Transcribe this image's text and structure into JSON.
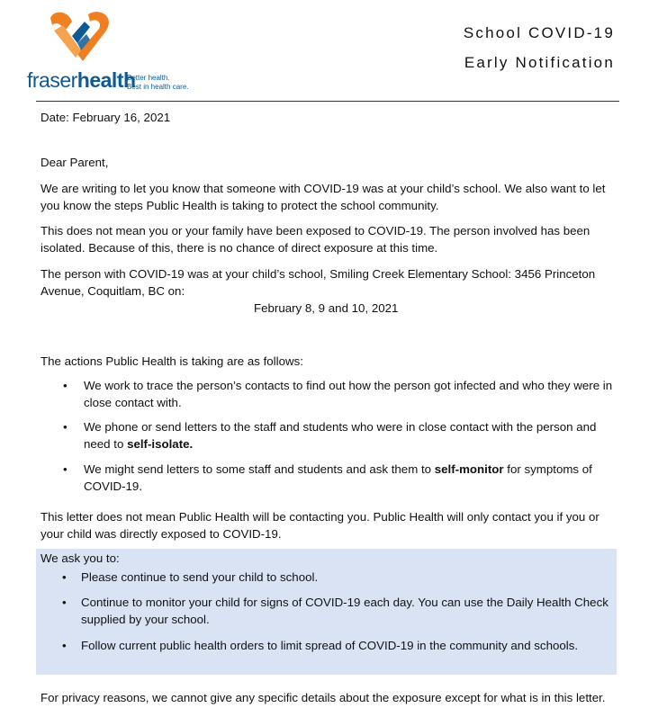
{
  "header": {
    "brand_light": "fraser",
    "brand_bold": "health",
    "tagline_1": "Better health.",
    "tagline_2": "Best in health care.",
    "title_line1": "School COVID-19",
    "title_line2": "Early Notification",
    "brand_colors": {
      "orange": "#f07f22",
      "blue": "#0e5a96"
    }
  },
  "date_line": "Date: February 16, 2021",
  "greeting": "Dear Parent,",
  "para1": "We are writing to let you know that someone with COVID-19 was at your child’s school. We also want to let you know the steps Public Health is taking to protect the school community.",
  "para2": "This does not mean you or your family have been exposed to COVID-19. The person involved has been isolated. Because of this, there is no chance of direct exposure at this time.",
  "para3": "The person with COVID-19 was at your child’s school, Smiling Creek Elementary School:  3456 Princeton Avenue, Coquitlam, BC on:",
  "dates": "February 8, 9 and 10, 2021",
  "actions_intro": "The actions Public Health is taking are as follows:",
  "actions": [
    {
      "text": "We work to trace the person’s contacts to find out how the person got infected and who they were in close contact with."
    },
    {
      "text": "We phone or send letters to the staff and students who were in close contact with the person and need to ",
      "bold": "self-isolate.",
      "after": ""
    },
    {
      "text": "We might send letters to some staff and students and ask them to ",
      "bold": "self-monitor",
      "after": " for symptoms of COVID-19."
    }
  ],
  "para4": "This letter does not mean Public Health will be contacting you. Public Health will only contact you if you or your child was directly exposed to COVID-19.",
  "ask": {
    "intro": "We ask you to:",
    "items": [
      "Please continue to send your child to school.",
      "Continue to monitor your child for signs of COVID-19 each day.  You can use the Daily Health Check supplied by your school.",
      "Follow current public health orders to limit spread of COVID-19 in the community and schools."
    ],
    "background": "#d9e3f4"
  },
  "privacy": "For privacy reasons, we cannot give any specific details about the exposure except for what is in this letter.",
  "bullet_glyph": "•"
}
